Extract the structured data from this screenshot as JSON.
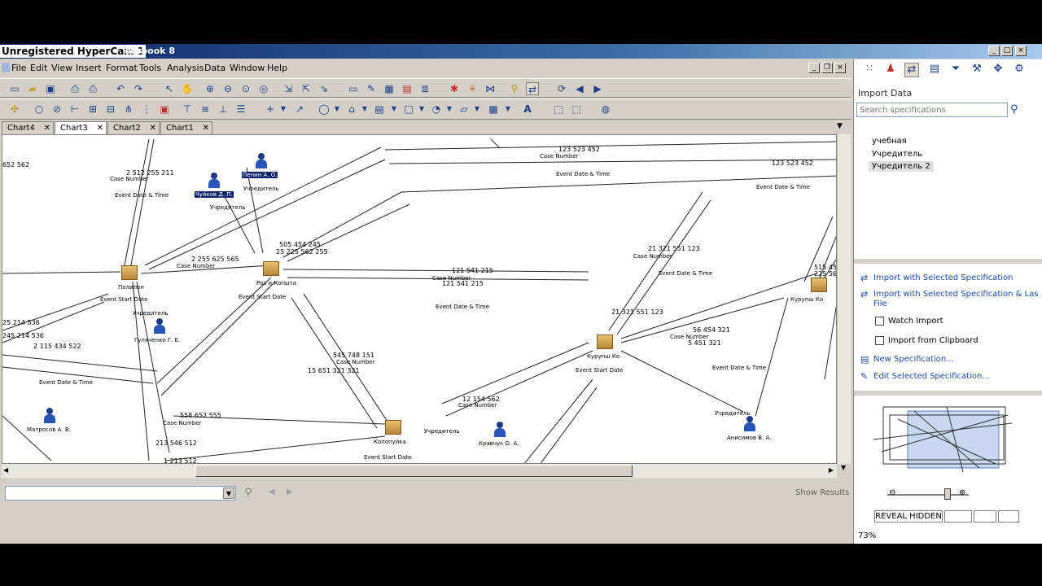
{
  "window": {
    "watermark": "Unregistered HyperCam 3",
    "title_rest": "otebook 8"
  },
  "menu": [
    "File",
    "Edit",
    "View",
    "Insert",
    "Format",
    "Tools",
    "Analysis",
    "Data",
    "Window",
    "Help"
  ],
  "tabs": [
    {
      "label": "Chart4",
      "active": false
    },
    {
      "label": "Chart3",
      "active": true
    },
    {
      "label": "Chart2",
      "active": false
    },
    {
      "label": "Chart1",
      "active": false
    }
  ],
  "bottom": {
    "show_results": "Show Results"
  },
  "right_pane": {
    "heading": "Import Data",
    "search_placeholder": "Search specifications",
    "specs": [
      "учебная",
      "Учредитель",
      "Учредитель 2"
    ],
    "selected_spec": "Учредитель 2",
    "actions": {
      "import_selected": "Import with Selected Specification",
      "import_selected_last_line1": "Import with Selected Specification & Las",
      "import_selected_last_line2": "File",
      "watch_import": "Watch Import",
      "import_clipboard": "Import from Clipboard",
      "new_spec": "New Specification...",
      "edit_spec": "Edit Selected Specification..."
    },
    "zoom": "73%",
    "status": "REVEAL HIDDEN"
  },
  "chart": {
    "entities": [
      {
        "id": "pol",
        "label": "Полилон",
        "num": ""
      },
      {
        "id": "ros",
        "label": "Роз и Копыта",
        "num": ""
      },
      {
        "id": "kur",
        "label": "Курупш Ко",
        "num": ""
      },
      {
        "id": "kur2",
        "label": "Курупш Ко",
        "num": ""
      },
      {
        "id": "kol",
        "label": "Колопуйка",
        "num": ""
      }
    ],
    "persons": [
      {
        "id": "p1",
        "label": "Пенин А. О.",
        "selected": true,
        "role": "Учредитель"
      },
      {
        "id": "p2",
        "label": "Чуйков Д. П.",
        "selected": true,
        "role": "Учредитель"
      },
      {
        "id": "p3",
        "label": "Гуляченко Г. Е.",
        "selected": false,
        "role": "Учредитель"
      },
      {
        "id": "p4",
        "label": "Матросов А. В.",
        "selected": false,
        "role": ""
      },
      {
        "id": "p5",
        "label": "Кравчук О. А.",
        "selected": false,
        "role": "Учредитель"
      },
      {
        "id": "p6",
        "label": "Анисимов В. А.",
        "selected": false,
        "role": "Учредитель"
      }
    ],
    "link_numbers": [
      "652 562",
      "2 512 255 211",
      "123 523 452",
      "123 523 452",
      "2 255 625 565",
      "505 454 245",
      "25 225 562 255",
      "121 541 215",
      "121 541 215",
      "21 321 551 123",
      "21 321 551 123",
      "56 454 321",
      "5 451 321",
      "515 450",
      "225 562",
      "25 214 536",
      "245 214 536",
      "2 115 434 522",
      "545 748 151",
      "15 651 321 321",
      "12 154 562",
      "558 652 555",
      "213 546 512",
      "1 213 512"
    ],
    "case_label": "Case Number",
    "event_label": "Event Date & Time",
    "event_start_label": "Event Start Date"
  }
}
